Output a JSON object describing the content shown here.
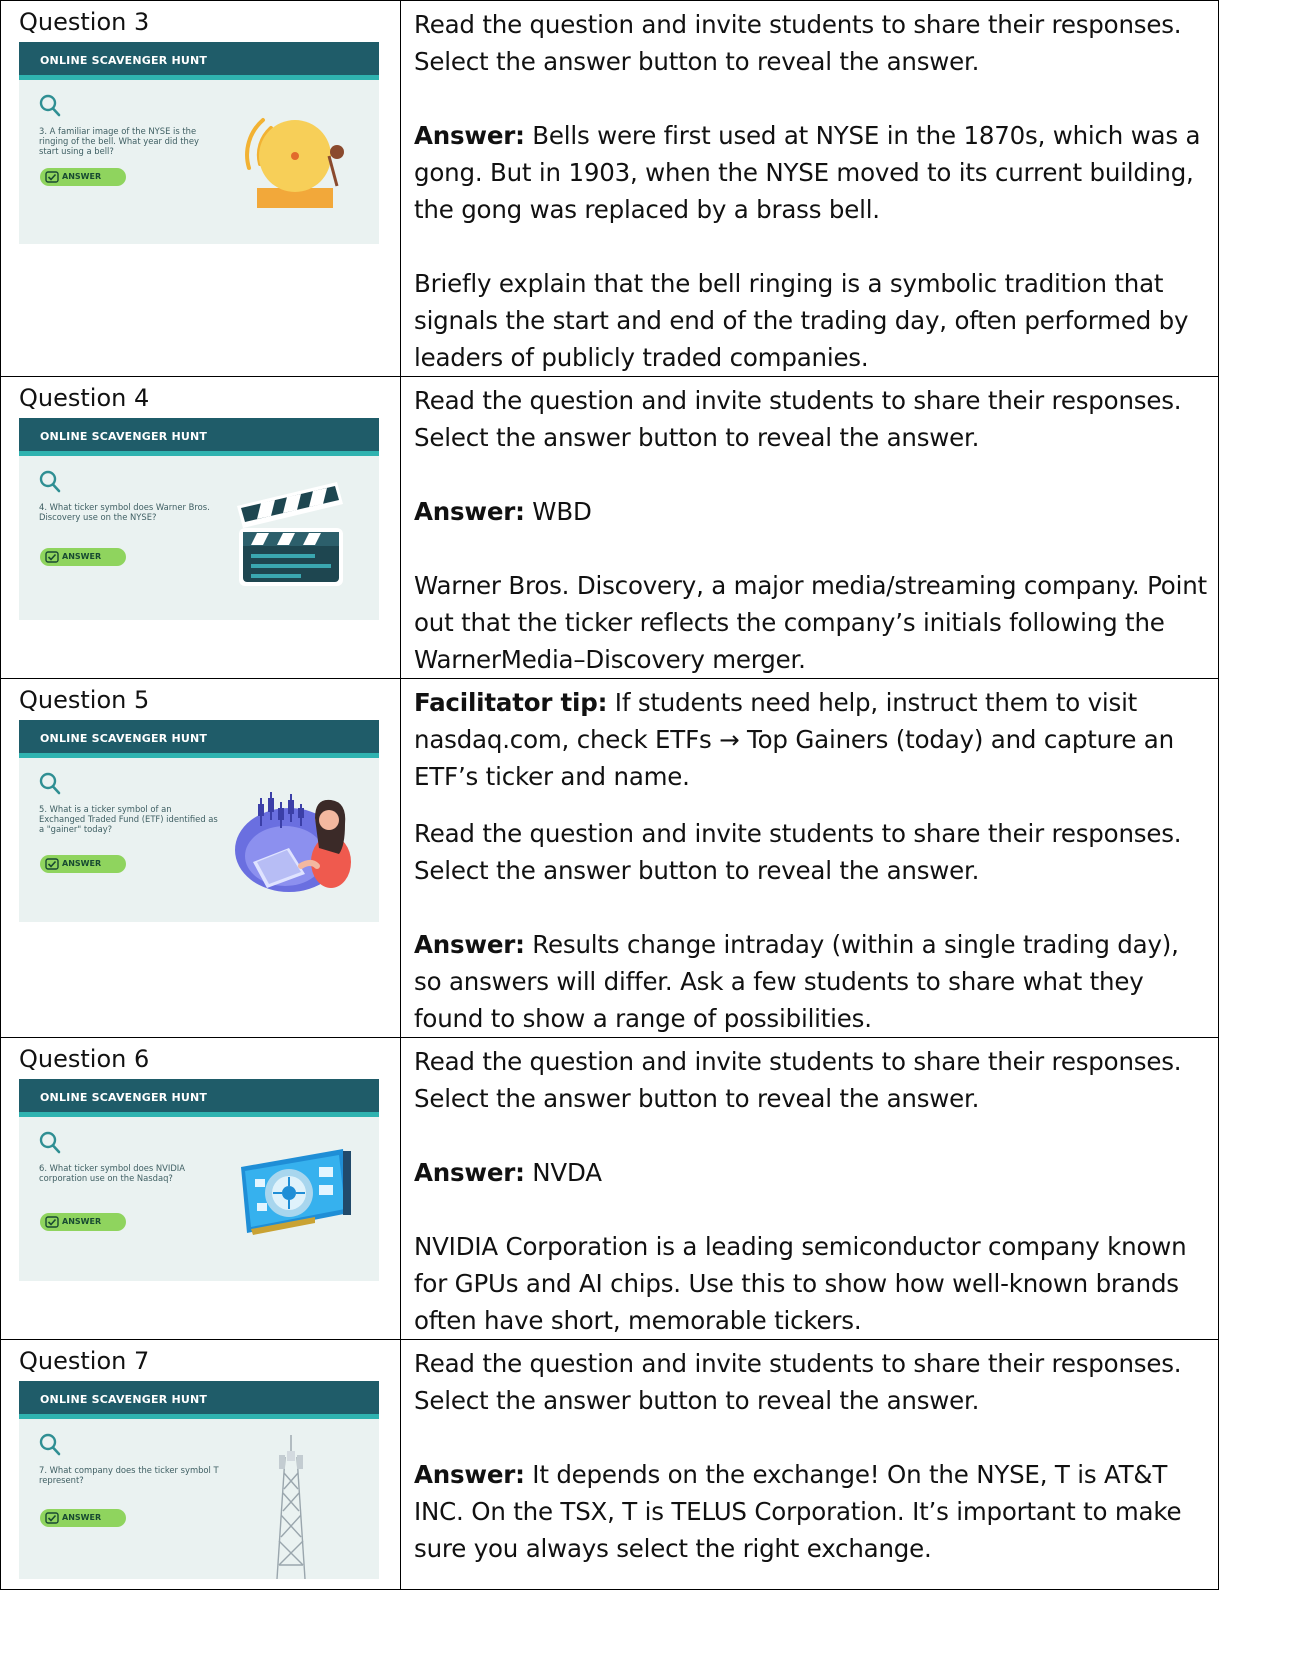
{
  "slide": {
    "header": "ONLINE SCAVENGER HUNT",
    "answer_label": "ANSWER"
  },
  "rows": [
    {
      "label": "Question 3",
      "slide_question": "3. A familiar image of the NYSE is the ringing of the bell. What year did they start using a bell?",
      "art": "bell-illustration",
      "intro": "Read the question and invite students to share their responses. Select the answer button to reveal the answer.",
      "answer_label": "Answer:",
      "answer": " Bells were first used at NYSE in the 1870s, which was a gong.  But in 1903, when the NYSE moved to its current building, the gong was replaced by a brass bell.",
      "note": "Briefly explain that the bell ringing is a symbolic tradition that signals the start and end of the trading day, often performed by leaders of publicly traded companies."
    },
    {
      "label": "Question 4",
      "slide_question": "4. What ticker symbol does Warner Bros. Discovery use on the NYSE?",
      "art": "clapperboard-illustration",
      "intro": "Read the question and invite students to share their responses. Select the answer button to reveal the answer.",
      "answer_label": "Answer:",
      "answer": " WBD",
      "note": "Warner Bros. Discovery, a major media/streaming company. Point out that the ticker reflects the company’s initials following the WarnerMedia–Discovery merger."
    },
    {
      "label": "Question 5",
      "slide_question": "5. What is a ticker symbol of an Exchanged Traded Fund (ETF) identified as a \"gainer\" today?",
      "art": "trader-illustration",
      "tip_label": "Facilitator tip:",
      "tip": " If students need help, instruct them to visit nasdaq.com, check ETFs → Top Gainers (today) and capture an ETF’s ticker and name.",
      "intro": "Read the question and invite students to share their responses. Select the answer button to reveal the answer.",
      "answer_label": "Answer:",
      "answer": " Results change intraday (within a single trading day), so answers will differ. Ask a few students to share what they found to show a range of possibilities."
    },
    {
      "label": "Question 6",
      "slide_question": "6. What ticker symbol does NVIDIA corporation use on the Nasdaq?",
      "art": "gpu-card-illustration",
      "intro": "Read the question and invite students to share their responses. Select the answer button to reveal the answer.",
      "answer_label": "Answer:",
      "answer": " NVDA",
      "note": "NVIDIA Corporation is a leading semiconductor company known for GPUs and AI chips. Use this to show how well-known brands often have short, memorable tickers."
    },
    {
      "label": "Question 7",
      "slide_question": "7. What company does the ticker symbol T represent?",
      "art": "cell-tower-illustration",
      "intro": "Read the question and invite students to share their responses. Select the answer button to reveal the answer.",
      "answer_label": "Answer:",
      "answer": " It depends on the exchange! On the NYSE, T is AT&T INC. On the TSX, T is TELUS Corporation. It’s important to make sure you always select the right exchange."
    }
  ]
}
